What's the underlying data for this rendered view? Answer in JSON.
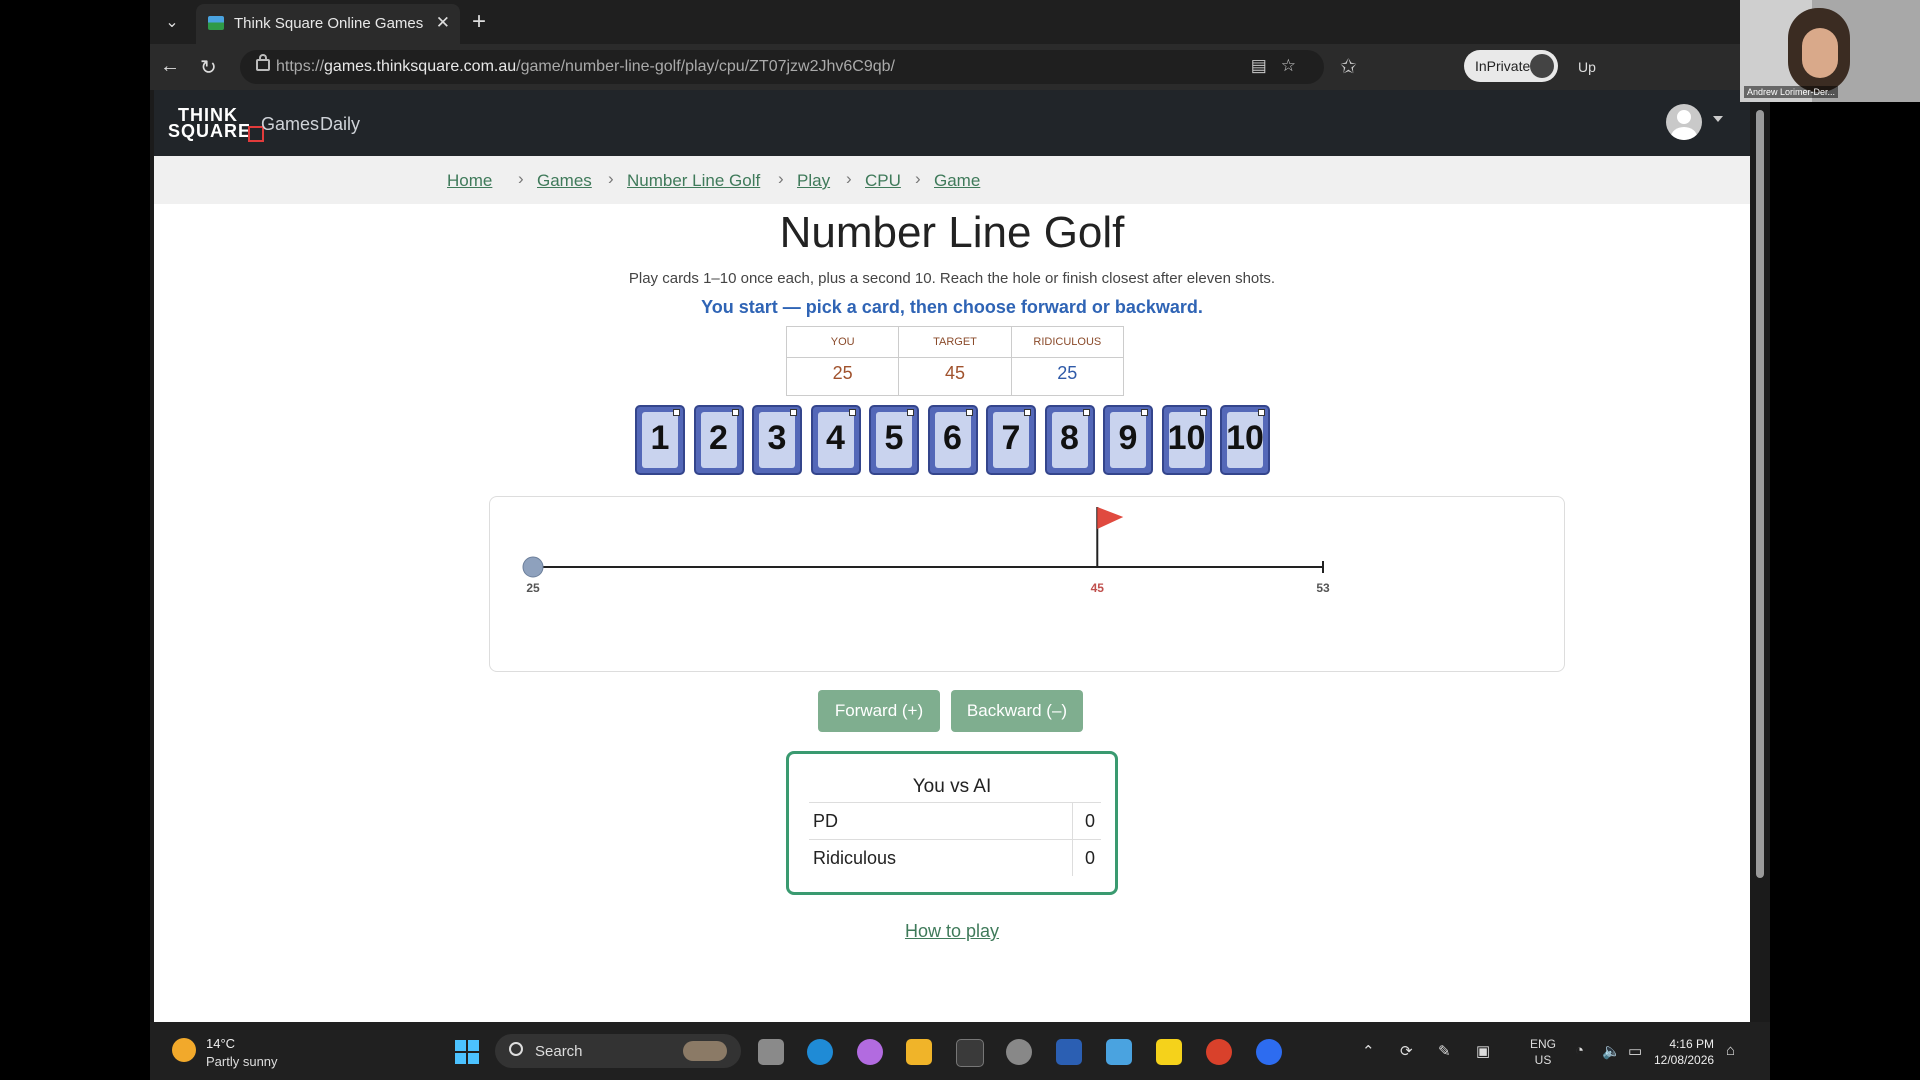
{
  "browser": {
    "tab_title": "Think Square Online Games",
    "url_prefix": "https://",
    "url_host": "games.thinksquare.com.au",
    "url_path": "/game/number-line-golf/play/cpu/ZT07jzw2Jhv6C9qb/",
    "inprivate_label": "InPrivate",
    "update_label": "Up"
  },
  "site": {
    "logo_line1": "THINK",
    "logo_line2": "SQUARE",
    "nav": [
      "Games",
      "Daily"
    ]
  },
  "breadcrumbs": [
    "Home",
    "Games",
    "Number Line Golf",
    "Play",
    "CPU",
    "Game"
  ],
  "game": {
    "title": "Number Line Golf",
    "subtitle": "Play cards 1–10 once each, plus a second 10. Reach the hole or finish closest after eleven shots.",
    "prompt": "You start — pick a card, then choose forward or backward.",
    "score": [
      {
        "label": "YOU",
        "value": "25",
        "color": "#a0522d"
      },
      {
        "label": "TARGET",
        "value": "45",
        "color": "#a0522d"
      },
      {
        "label": "RIDICULOUS",
        "value": "25",
        "color": "#2f5aa8"
      }
    ],
    "cards": [
      "1",
      "2",
      "3",
      "4",
      "5",
      "6",
      "7",
      "8",
      "9",
      "10",
      "10"
    ],
    "line": {
      "start": 25,
      "target": 45,
      "end": 53,
      "ball": 25,
      "start_label": "25",
      "target_label": "45",
      "end_label": "53"
    },
    "forward_label": "Forward (+)",
    "backward_label": "Backward (–)",
    "scoreboard": {
      "title": "You vs AI",
      "rows": [
        {
          "name": "PD",
          "value": "0"
        },
        {
          "name": "Ridiculous",
          "value": "0"
        }
      ]
    },
    "howto_label": "How to play"
  },
  "taskbar": {
    "temp": "14°C",
    "condition": "Partly sunny",
    "search_label": "Search",
    "lang1": "ENG",
    "lang2": "US",
    "time": "4:16 PM",
    "date": "12/08/2026"
  },
  "webcam": {
    "name": "Andrew Lorimer-Der..."
  }
}
